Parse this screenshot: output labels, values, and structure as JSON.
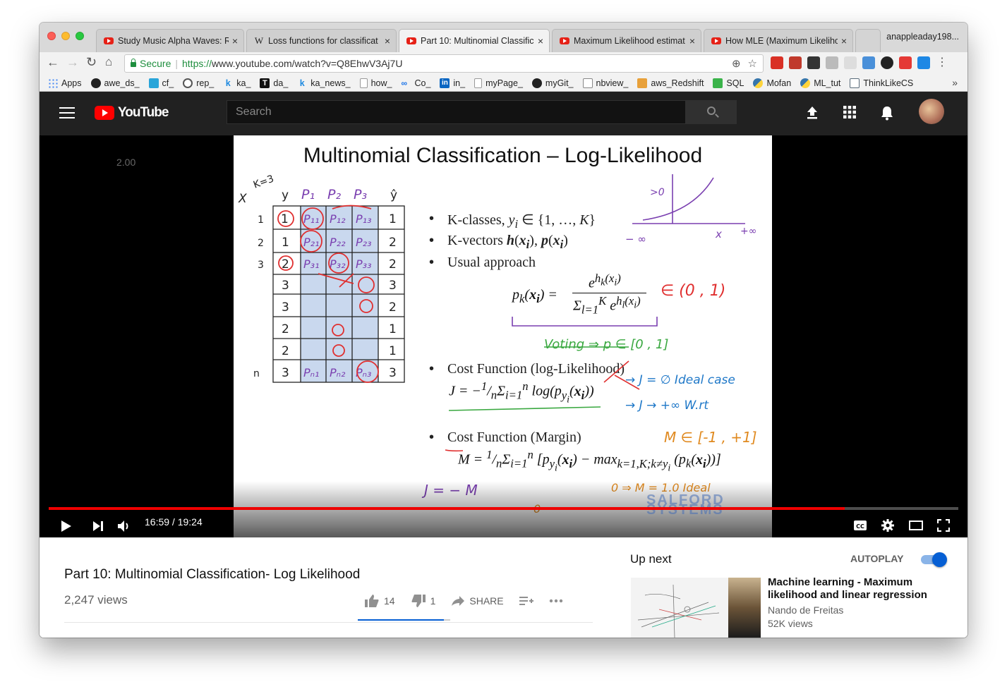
{
  "browser": {
    "tabs": [
      {
        "title": "Study Music Alpha Waves: R",
        "favicon": "youtube-icon",
        "active": false
      },
      {
        "title": "Loss functions for classificat",
        "favicon": "wikipedia-icon",
        "active": false
      },
      {
        "title": "Part 10: Multinomial Classific",
        "favicon": "youtube-icon",
        "active": true
      },
      {
        "title": "Maximum Likelihood estimat",
        "favicon": "youtube-icon",
        "active": false
      },
      {
        "title": "How MLE (Maximum Likeliho",
        "favicon": "youtube-icon",
        "active": false
      }
    ],
    "profile_name": "anappleaday198...",
    "secure_label": "Secure",
    "url_scheme": "https://",
    "url_rest": "www.youtube.com/watch?v=Q8EhwV3Aj7U",
    "bookmarks": [
      "Apps",
      "awe_ds_",
      "cf_",
      "rep_",
      "ka_",
      "da_",
      "ka_news_",
      "how_",
      "Co_",
      "in_",
      "myPage_",
      "myGit_",
      "nbview_",
      "aws_Redshift",
      "SQL",
      "Mofan",
      "ML_tut",
      "ThinkLikeCS"
    ],
    "bookmark_colors": [
      "#4285f4",
      "#222222",
      "#2aa5d9",
      "#555555",
      "#1f8ae0",
      "#111111",
      "#1f8ae0",
      "#999999",
      "#1a73e8",
      "#0a66c2",
      "#999999",
      "#222222",
      "#888888",
      "#e8a13b",
      "#3bb34a",
      "#3776ab",
      "#3776ab",
      "#5a6b7a"
    ]
  },
  "youtube": {
    "logo_text": "YouTube",
    "search_placeholder": "Search",
    "accent": "#ff0000"
  },
  "player": {
    "playback_speed_text": "2.00",
    "time_display": "16:59 / 19:24",
    "progress_fraction": 0.875
  },
  "slide": {
    "title": "Multinomial Classification – Log-Likelihood",
    "bullets": [
      "K-classes,",
      "K-vectors",
      "Usual approach",
      "Cost Function (log-Likelihood)",
      "Cost Function (Margin)"
    ],
    "watermark": "SALFORD SYSTEMS"
  },
  "video": {
    "title": "Part 10: Multinomial Classification- Log Likelihood",
    "views": "2,247 views",
    "likes": "14",
    "dislikes": "1",
    "share_label": "SHARE"
  },
  "sidebar": {
    "up_next": "Up next",
    "autoplay_label": "AUTOPLAY",
    "autoplay_on": true,
    "recommendation": {
      "title": "Machine learning - Maximum likelihood and linear regression",
      "channel": "Nando de Freitas",
      "views": "52K views"
    }
  }
}
